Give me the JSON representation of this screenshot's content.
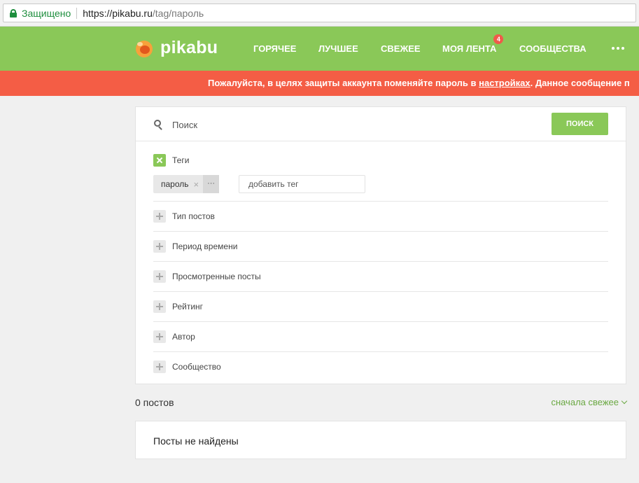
{
  "browser": {
    "secure_label": "Защищено",
    "url_host": "https://pikabu.ru",
    "url_path": "/tag/пароль"
  },
  "header": {
    "logo_text": "pikabu",
    "nav": [
      {
        "label": "ГОРЯЧЕЕ"
      },
      {
        "label": "ЛУЧШЕЕ"
      },
      {
        "label": "СВЕЖЕЕ"
      },
      {
        "label": "МОЯ ЛЕНТА",
        "badge": "4"
      },
      {
        "label": "СООБЩЕСТВА"
      }
    ]
  },
  "banner": {
    "text_before": "Пожалуйста, в целях защиты аккаунта поменяйте пароль в ",
    "link_text": "настройках",
    "text_after": ". Данное сообщение п"
  },
  "search": {
    "placeholder": "Поиск",
    "button_label": "ПОИСК"
  },
  "filters": {
    "tags_label": "Теги",
    "tag": "пароль",
    "tag_remove": "×",
    "tag_more": "···",
    "add_tag_placeholder": "добавить тег",
    "rows": [
      {
        "label": "Тип постов"
      },
      {
        "label": "Период времени"
      },
      {
        "label": "Просмотренные посты"
      },
      {
        "label": "Рейтинг"
      },
      {
        "label": "Автор"
      },
      {
        "label": "Сообщество"
      }
    ]
  },
  "results": {
    "count": "0 постов",
    "sort": "сначала свежее",
    "empty": "Посты не найдены"
  },
  "colors": {
    "brand_green": "#8ac858",
    "banner_red": "#f45d45",
    "link_green": "#6aa842"
  }
}
